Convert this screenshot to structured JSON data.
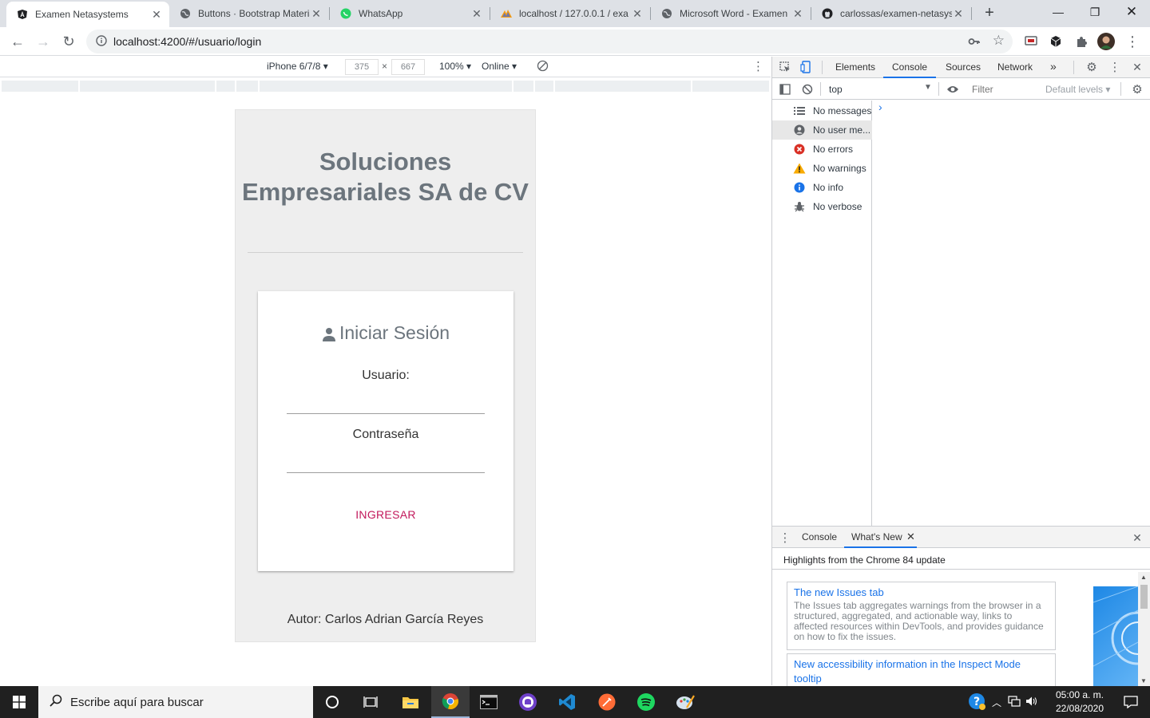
{
  "browser": {
    "tabs": [
      {
        "label": "Examen Netasystems",
        "icon": "angular-icon",
        "active": true
      },
      {
        "label": "Buttons · Bootstrap Material",
        "icon": "globe-icon"
      },
      {
        "label": "WhatsApp",
        "icon": "whatsapp-icon"
      },
      {
        "label": "localhost / 127.0.0.1 / exa",
        "icon": "phpmyadmin-icon"
      },
      {
        "label": "Microsoft Word - Examen",
        "icon": "globe-icon"
      },
      {
        "label": "carlossas/examen-netasys",
        "icon": "github-icon"
      }
    ],
    "new_tab": "+",
    "url": "localhost:4200/#/usuario/login"
  },
  "device_toolbar": {
    "device": "iPhone 6/7/8",
    "width": "375",
    "times": "×",
    "height": "667",
    "zoom": "100%",
    "network": "Online"
  },
  "page": {
    "company": "Soluciones Empresariales SA de CV",
    "card_title": "Iniciar Sesión",
    "user_label": "Usuario:",
    "password_label": "Contraseña",
    "submit_label": "INGRESAR",
    "author": "Autor: Carlos Adrian García Reyes"
  },
  "devtools": {
    "tabs": [
      "Elements",
      "Console",
      "Sources",
      "Network"
    ],
    "active_tab": "Console",
    "more": "»",
    "context": "top",
    "filter_placeholder": "Filter",
    "levels": "Default levels",
    "sidebar": [
      {
        "label": "No messages",
        "icon": "list-icon"
      },
      {
        "label": "No user me...",
        "icon": "user-icon",
        "selected": true
      },
      {
        "label": "No errors",
        "icon": "error-icon"
      },
      {
        "label": "No warnings",
        "icon": "warning-icon"
      },
      {
        "label": "No info",
        "icon": "info-icon"
      },
      {
        "label": "No verbose",
        "icon": "bug-icon"
      }
    ],
    "prompt": "›",
    "drawer_tabs": [
      "Console",
      "What's New"
    ],
    "drawer_active": "What's New",
    "highlights": "Highlights from the Chrome 84 update",
    "cards": [
      {
        "title": "The new Issues tab",
        "desc": "The Issues tab aggregates warnings from the browser in a structured, aggregated, and actionable way, links to affected resources within DevTools, and provides guidance on how to fix the issues."
      },
      {
        "title": "New accessibility information in the Inspect Mode tooltip",
        "desc": ""
      }
    ]
  },
  "taskbar": {
    "search_placeholder": "Escribe aquí para buscar",
    "time": "05:00 a. m.",
    "date": "22/08/2020",
    "colors": {
      "accent": "#c2185b",
      "heading": "#6c757d",
      "link": "#1a73e8"
    }
  }
}
